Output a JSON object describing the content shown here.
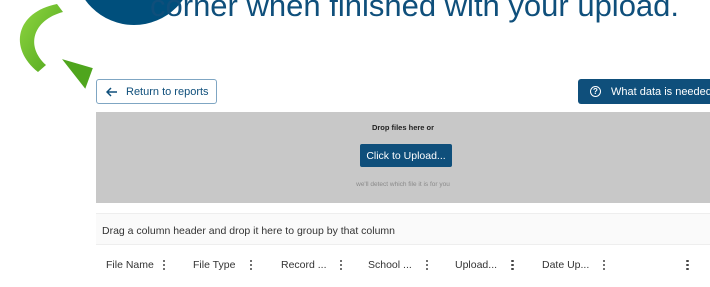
{
  "callout": {
    "text": "corner when finished with your upload."
  },
  "toolbar": {
    "return_label": "Return to reports",
    "help_label": "What data is needed?"
  },
  "dropzone": {
    "title": "Drop files here or",
    "button_label": "Click to Upload...",
    "hint": "we'll detect which file it is for you"
  },
  "grid": {
    "group_hint": "Drag a column header and drop it here to group by that column",
    "columns": [
      {
        "label": "File Name"
      },
      {
        "label": "File Type"
      },
      {
        "label": "Record ..."
      },
      {
        "label": "School ..."
      },
      {
        "label": "Upload..."
      },
      {
        "label": "Date Up..."
      }
    ]
  },
  "colors": {
    "brand_blue": "#0f4f7b",
    "dropzone_gray": "#c8c8c8",
    "arrow_green": "#6cbf2b"
  },
  "icons": {
    "return": "arrow-left-icon",
    "help": "question-circle-icon",
    "column_menu": "kebab-icon",
    "callout_arrow": "curved-green-arrow-icon"
  }
}
